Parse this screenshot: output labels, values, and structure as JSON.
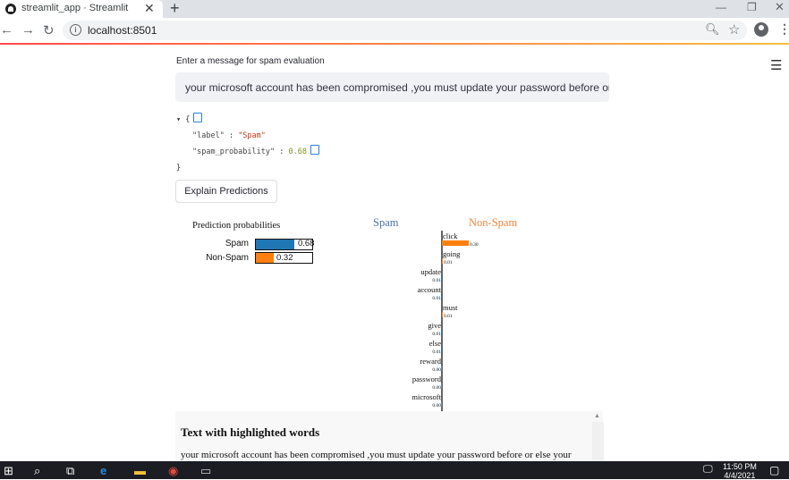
{
  "browser": {
    "tab_title": "streamlit_app · Streamlit",
    "url": "localhost:8501"
  },
  "app": {
    "input_label": "Enter a message for spam evaluation",
    "input_value": "your microsoft account has been compromised ,you must update your password before or else",
    "json": {
      "label_key": "\"label\"",
      "label_value": "\"Spam\"",
      "prob_key": "\"spam_probability\"",
      "prob_value": "0.68"
    },
    "explain_button": "Explain Predictions"
  },
  "lime": {
    "pred_title": "Prediction probabilities",
    "class_left": "Spam",
    "class_right": "Non-Spam",
    "colors": {
      "spam": "#1f77b4",
      "nonspam": "#ff7f0e"
    },
    "probs": [
      {
        "label": "Spam",
        "value": 0.68,
        "text": "0.68",
        "color": "#1f77b4"
      },
      {
        "label": "Non-Spam",
        "value": 0.32,
        "text": "0.32",
        "color": "#ff7f0e"
      }
    ],
    "features": [
      {
        "word": "click",
        "weight": 0.3,
        "text": "0.30",
        "side": "right"
      },
      {
        "word": "going",
        "weight": 0.01,
        "text": "0.01",
        "side": "right"
      },
      {
        "word": "update",
        "weight": 0.01,
        "text": "0.01",
        "side": "left"
      },
      {
        "word": "account",
        "weight": 0.01,
        "text": "0.01",
        "side": "left"
      },
      {
        "word": "must",
        "weight": 0.01,
        "text": "0.01",
        "side": "right"
      },
      {
        "word": "give",
        "weight": 0.01,
        "text": "0.01",
        "side": "left"
      },
      {
        "word": "else",
        "weight": 0.01,
        "text": "0.01",
        "side": "left"
      },
      {
        "word": "reward",
        "weight": 0.0,
        "text": "0.00",
        "side": "left"
      },
      {
        "word": "password",
        "weight": 0.0,
        "text": "0.00",
        "side": "left"
      },
      {
        "word": "microsoft",
        "weight": 0.0,
        "text": "0.00",
        "side": "left"
      }
    ]
  },
  "highlight": {
    "title": "Text with highlighted words",
    "text": "your microsoft account has been compromised ,you must update your password before or else your"
  },
  "taskbar": {
    "time": "11:50 PM",
    "date": "4/4/2021"
  }
}
